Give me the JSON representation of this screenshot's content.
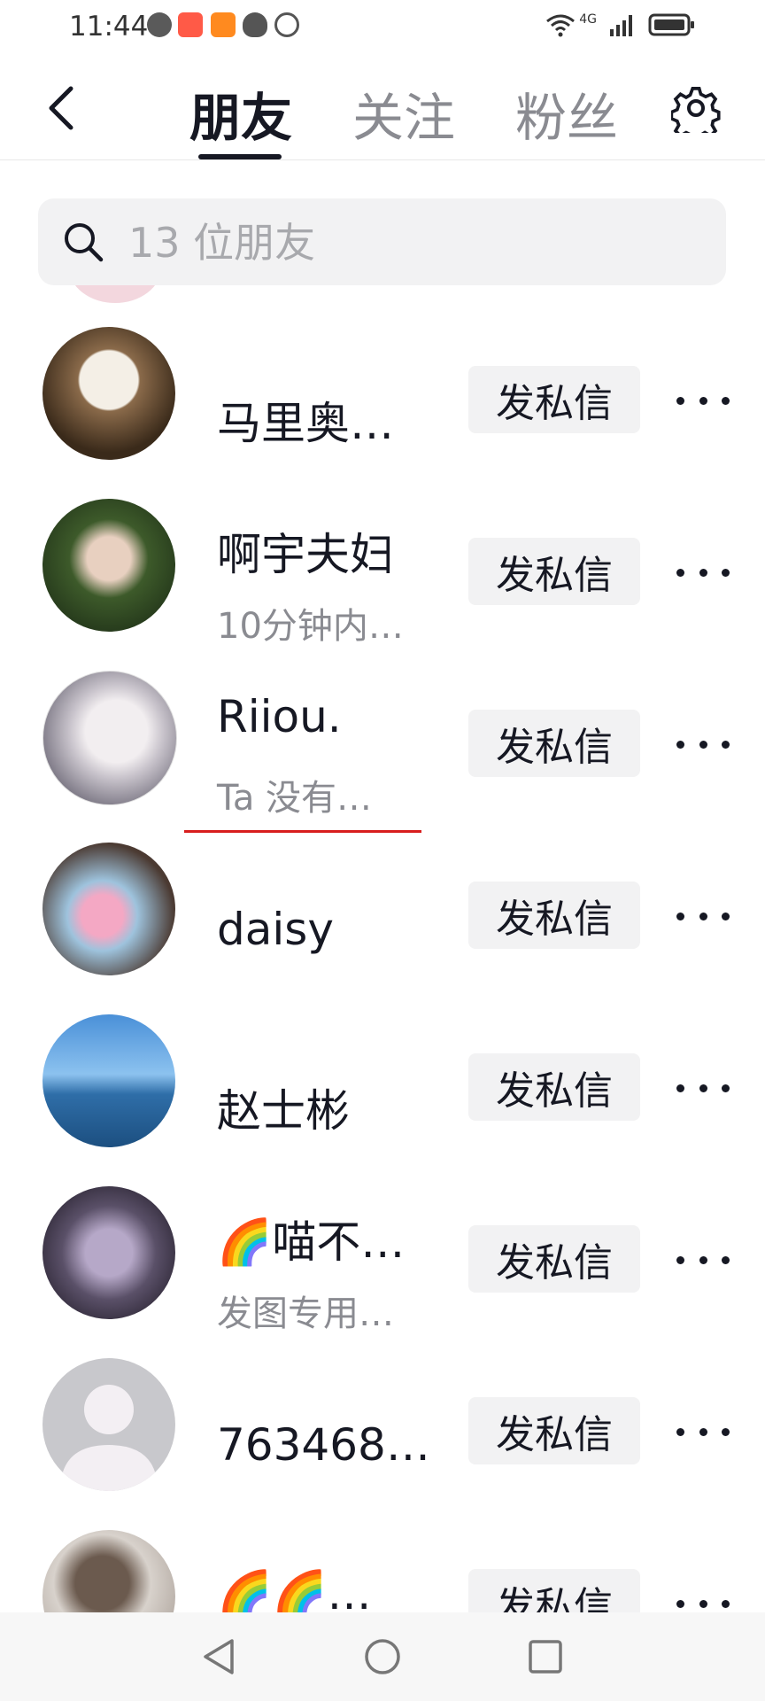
{
  "status_bar": {
    "time": "11:44",
    "network": "4G",
    "left_icons": [
      "basketball-app-icon",
      "shopping-app-icon",
      "video-app-icon",
      "qq-penguin-icon",
      "hand-app-icon"
    ],
    "right_icons": [
      "wifi-icon",
      "signal-icon",
      "battery-icon"
    ]
  },
  "header": {
    "tabs": [
      {
        "label": "朋友",
        "active": true
      },
      {
        "label": "关注",
        "active": false
      },
      {
        "label": "粉丝",
        "active": false
      }
    ],
    "back_icon": "chevron-left-icon",
    "settings_icon": "gear-icon"
  },
  "search": {
    "placeholder": "13 位朋友",
    "icon": "search-icon"
  },
  "friends": [
    {
      "name": "马里奥…",
      "subtitle": "",
      "button": "发私信",
      "avatar": "white-cat-photo"
    },
    {
      "name": "啊宇夫妇",
      "subtitle": "10分钟内…",
      "button": "发私信",
      "avatar": "couple-photo"
    },
    {
      "name": "Riiou.",
      "subtitle": "Ta 没有…",
      "button": "发私信",
      "avatar": "anime-girl-photo"
    },
    {
      "name": "daisy",
      "subtitle": "",
      "button": "发私信",
      "avatar": "girl-with-flowers-photo"
    },
    {
      "name": "赵士彬",
      "subtitle": "",
      "button": "发私信",
      "avatar": "sea-photo"
    },
    {
      "name": "🌈喵不…",
      "subtitle": "发图专用…",
      "button": "发私信",
      "avatar": "fantasy-character-photo"
    },
    {
      "name": "763468…",
      "subtitle": "",
      "button": "发私信",
      "avatar": "default-avatar"
    },
    {
      "name": "🌈🌈…",
      "subtitle": "",
      "button": "发私信",
      "avatar": "cat-photo"
    }
  ],
  "nav_bar": {
    "icons": [
      "back-triangle-icon",
      "home-circle-icon",
      "recents-square-icon"
    ]
  },
  "colors": {
    "annotation_underline": "#d81e1e",
    "button_bg": "#f2f2f3",
    "text_primary": "#161823",
    "text_secondary": "#8a8b91"
  }
}
